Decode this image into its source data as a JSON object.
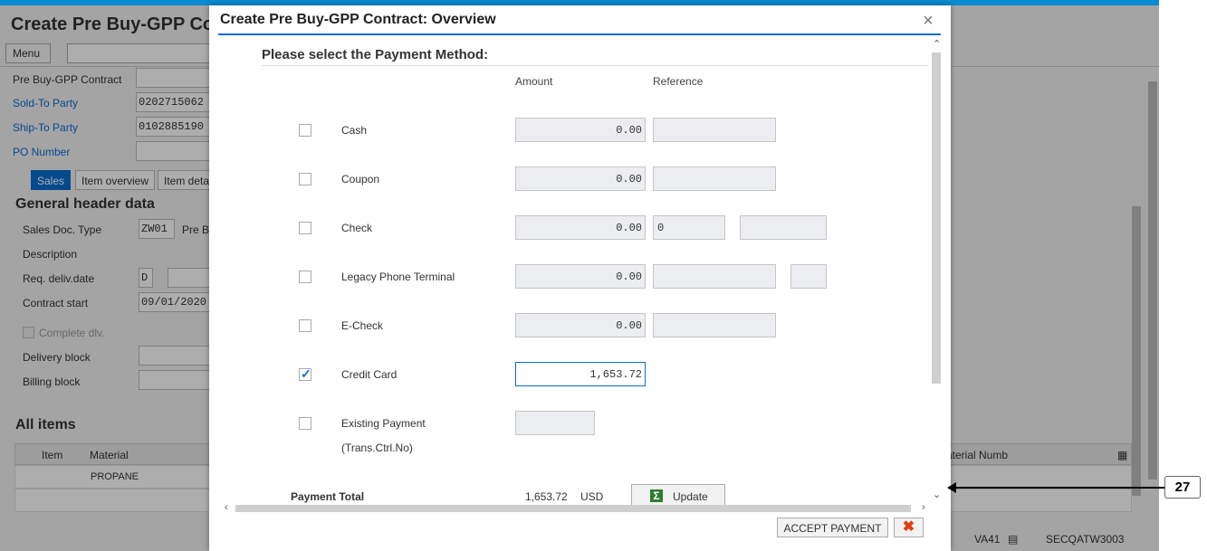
{
  "background": {
    "title": "Create Pre Buy-GPP Co",
    "menu_label": "Menu",
    "fields": {
      "contract_label": "Pre Buy-GPP Contract",
      "sold_to_label": "Sold-To Party",
      "sold_to_value": "0202715062",
      "ship_to_label": "Ship-To Party",
      "ship_to_value": "0102885190",
      "po_label": "PO Number"
    },
    "tabs": [
      "Sales",
      "Item overview",
      "Item deta"
    ],
    "general_header": {
      "title": "General header data",
      "doc_type_label": "Sales Doc. Type",
      "doc_type_value": "ZW01",
      "doc_type_desc": "Pre B",
      "description_label": "Description",
      "req_deliv_label": "Req. deliv.date",
      "req_deliv_value": "D",
      "contract_start_label": "Contract start",
      "contract_start_value": "09/01/2020",
      "complete_dlv_label": "Complete dlv.",
      "delivery_block_label": "Delivery block",
      "billing_block_label": "Billing block"
    },
    "all_items": {
      "title": "All items",
      "col_item": "Item",
      "col_material": "Material",
      "col_material_numb": "aterial Numb",
      "row1_material": "PROPANE"
    },
    "status": {
      "tcode": "VA41",
      "server": "SECQATW3003"
    }
  },
  "dialog": {
    "title": "Create Pre Buy-GPP Contract: Overview",
    "subtitle": "Please select the Payment Method:",
    "col_amount": "Amount",
    "col_reference": "Reference",
    "methods": [
      {
        "label": "Cash",
        "amount": "0.00",
        "checked": false
      },
      {
        "label": "Coupon",
        "amount": "0.00",
        "checked": false
      },
      {
        "label": "Check",
        "amount": "0.00",
        "reference": "0",
        "checked": false
      },
      {
        "label": "Legacy Phone Terminal",
        "amount": "0.00",
        "checked": false
      },
      {
        "label": "E-Check",
        "amount": "0.00",
        "checked": false
      },
      {
        "label": "Credit Card",
        "amount": "1,653.72",
        "checked": true
      },
      {
        "label": "Existing Payment",
        "label2": "(Trans.Ctrl.No)",
        "checked": false
      }
    ],
    "payment_total_label": "Payment Total",
    "payment_total_value": "1,653.72",
    "currency": "USD",
    "update_label": "Update",
    "accept_label": "ACCEPT PAYMENT"
  },
  "annotation": {
    "number": "27"
  }
}
